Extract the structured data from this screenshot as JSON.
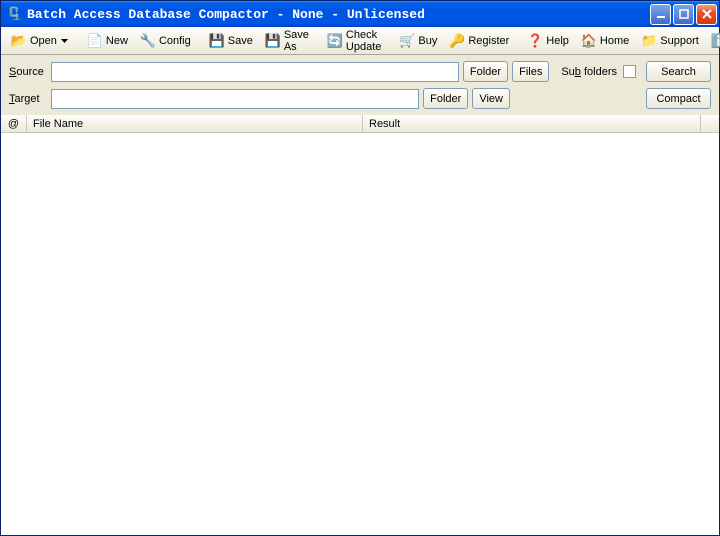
{
  "titlebar": {
    "title": "Batch Access Database Compactor - None - Unlicensed"
  },
  "toolbar": {
    "open": "Open",
    "new": "New",
    "config": "Config",
    "save": "Save",
    "saveas": "Save As",
    "checkupdate": "Check Update",
    "buy": "Buy",
    "register": "Register",
    "help": "Help",
    "home": "Home",
    "support": "Support",
    "about": "About"
  },
  "form": {
    "source_label_pre": "S",
    "source_label_rest": "ource",
    "target_label_pre": "T",
    "target_label_rest": "arget",
    "source_value": "",
    "target_value": "",
    "folder": "Folder",
    "files": "Files",
    "view": "View",
    "subfolders_pre": "Su",
    "subfolders_u": "b",
    "subfolders_rest": " folders",
    "search": "Search",
    "compact": "Compact"
  },
  "table": {
    "at": "@",
    "filename": "File Name",
    "result": "Result"
  }
}
